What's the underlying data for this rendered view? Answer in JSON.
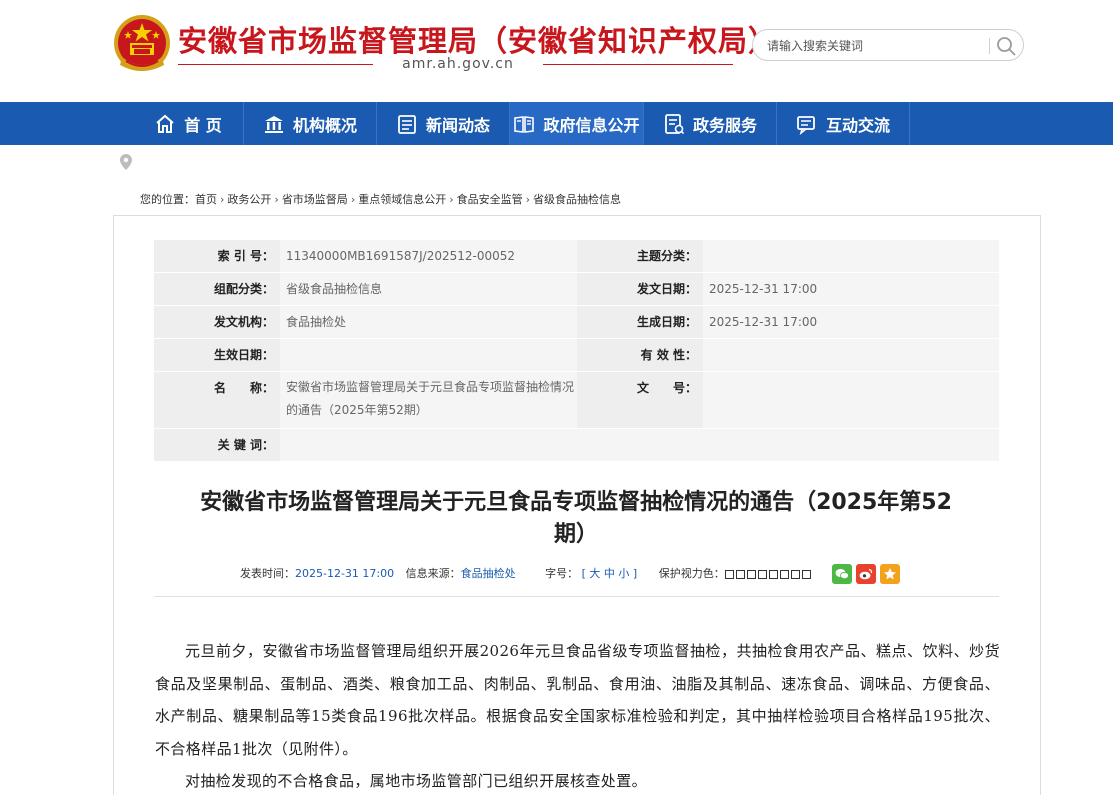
{
  "header": {
    "site_title": "安徽省市场监督管理局（安徽省知识产权局）",
    "site_domain": "amr.ah.gov.cn",
    "search_placeholder": "请输入搜索关键词"
  },
  "nav": {
    "items": [
      {
        "label": "首 页",
        "icon": "home-icon"
      },
      {
        "label": "机构概况",
        "icon": "institution-icon"
      },
      {
        "label": "新闻动态",
        "icon": "news-icon"
      },
      {
        "label": "政府信息公开",
        "icon": "open-info-icon"
      },
      {
        "label": "政务服务",
        "icon": "service-icon"
      },
      {
        "label": "互动交流",
        "icon": "interaction-icon"
      }
    ],
    "active_index": 3
  },
  "breadcrumb": {
    "prefix": "您的位置：",
    "items": [
      "首页",
      "政务公开",
      "省市场监督局",
      "重点领域信息公开",
      "食品安全监管",
      "省级食品抽检信息"
    ],
    "separator": "›"
  },
  "meta": {
    "index_label": "索 引 号：",
    "index_value": "11340000MB1691587J/202512-00052",
    "topic_label": "主题分类：",
    "topic_value": "",
    "category_label": "组配分类：",
    "category_value": "省级食品抽检信息",
    "pub_date_label": "发文日期：",
    "pub_date_value": "2025-12-31 17:00",
    "issuer_label": "发文机构：",
    "issuer_value": "食品抽检处",
    "created_label": "生成日期：",
    "created_value": "2025-12-31 17:00",
    "effective_label": "生效日期：",
    "effective_value": "",
    "validity_label": "有 效 性：",
    "validity_value": "",
    "name_label": "名　　称：",
    "name_value_line1": "安徽省市场监督管理局关于元旦食品专项监督抽检情况",
    "name_value_line2": "的通告（2025年第52期）",
    "doc_no_label": "文　　号：",
    "doc_no_value": "",
    "keywords_label": "关 键 词：",
    "keywords_value": ""
  },
  "article": {
    "title_line1": "安徽省市场监督管理局关于元旦食品专项监督抽检情况的通告（2025年第52",
    "title_line2": "期）",
    "publish_time_label": "发表时间：",
    "publish_time": "2025-12-31 17:00",
    "source_label": "信息来源：",
    "source": "食品抽检处",
    "font_size_label": "字号：",
    "font_size_open": "[",
    "font_large": "大",
    "font_medium": "中",
    "font_small": "小",
    "font_size_close": "]",
    "eye_care_label": "保护视力色：",
    "eye_care_colors": [
      "#ffffff",
      "#ffffff",
      "#ffffff",
      "#ffffff",
      "#ffffff",
      "#ffffff",
      "#ffffff",
      "#ffffff"
    ],
    "paragraph1_line1": "元旦前夕，安徽省市场监督管理局组织开展2026年元旦食品省级专项监督抽检，共抽检食用农产品、糕点、",
    "paragraph1_line2": "饮料、炒货食品及坚果制品、蛋制品、酒类、粮食加工品、肉制品、乳制品、食用油、油脂及其制品、速冻食",
    "paragraph1_line3": "品、调味品、方便食品、水产制品、糖果制品等15类食品196批次样品。根据食品安全国家标准检验和判定，其中",
    "paragraph1_line4": "抽样检验项目合格样品195批次、不合格样品1批次（见附件）。",
    "paragraph2": "对抽检发现的不合格食品，属地市场监管部门已组织开展核查处置。"
  },
  "colors": {
    "brand_red": "#c8161d",
    "nav_blue": "#1a5ab0",
    "nav_active": "#2769c4",
    "wechat_green": "#4cb945",
    "weibo_red": "#e8412f",
    "favorite_orange": "#f3a21c"
  }
}
